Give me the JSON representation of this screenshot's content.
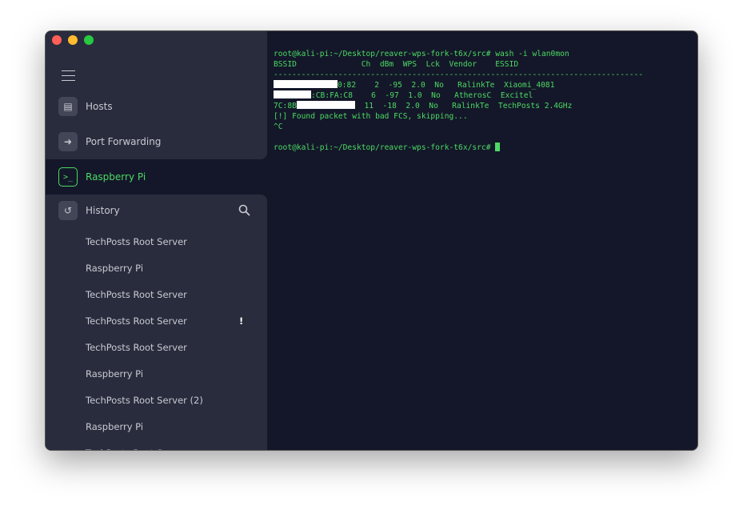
{
  "window": {
    "controls": {
      "close_color": "#ff5f57",
      "minimize_color": "#febc2e",
      "zoom_color": "#28c840"
    }
  },
  "sidebar": {
    "nav": [
      {
        "label": "Hosts",
        "icon": "server-icon"
      },
      {
        "label": "Port Forwarding",
        "icon": "forward-arrow-icon"
      },
      {
        "label": "Raspberry Pi",
        "icon": "terminal-icon",
        "active": true
      }
    ],
    "history": {
      "label": "History",
      "icon": "history-icon",
      "search_icon": "search-icon",
      "items": [
        {
          "label": "TechPosts Root Server"
        },
        {
          "label": "Raspberry Pi"
        },
        {
          "label": "TechPosts Root Server"
        },
        {
          "label": "TechPosts Root Server",
          "warning": "!"
        },
        {
          "label": "TechPosts Root Server"
        },
        {
          "label": "Raspberry Pi"
        },
        {
          "label": "TechPosts Root Server (2)"
        },
        {
          "label": "Raspberry Pi"
        },
        {
          "label": "TechPosts Root Server"
        }
      ]
    }
  },
  "terminal": {
    "accent": "#4cd964",
    "prompt": "root@kali-pi:~/Desktop/reaver-wps-fork-t6x/src# ",
    "command": "wash -i wlan0mon",
    "header": "BSSID              Ch  dBm  WPS  Lck  Vendor    ESSID",
    "divider": "--------------------------------------------------------------------------------",
    "rows": [
      {
        "bssid_visible": "0:82",
        "rest": "    2  -95  2.0  No   RalinkTe  Xiaomi_4081"
      },
      {
        "bssid_visible": ":CB:FA:C8",
        "rest": "    6  -97  1.0  No   AtherosC  Excitel"
      },
      {
        "bssid_visible": "7C:8B",
        "rest": "  11  -18  2.0  No   RalinkTe  TechPosts 2.4GHz"
      }
    ],
    "message": "[!] Found packet with bad FCS, skipping...",
    "interrupt": "^C"
  }
}
